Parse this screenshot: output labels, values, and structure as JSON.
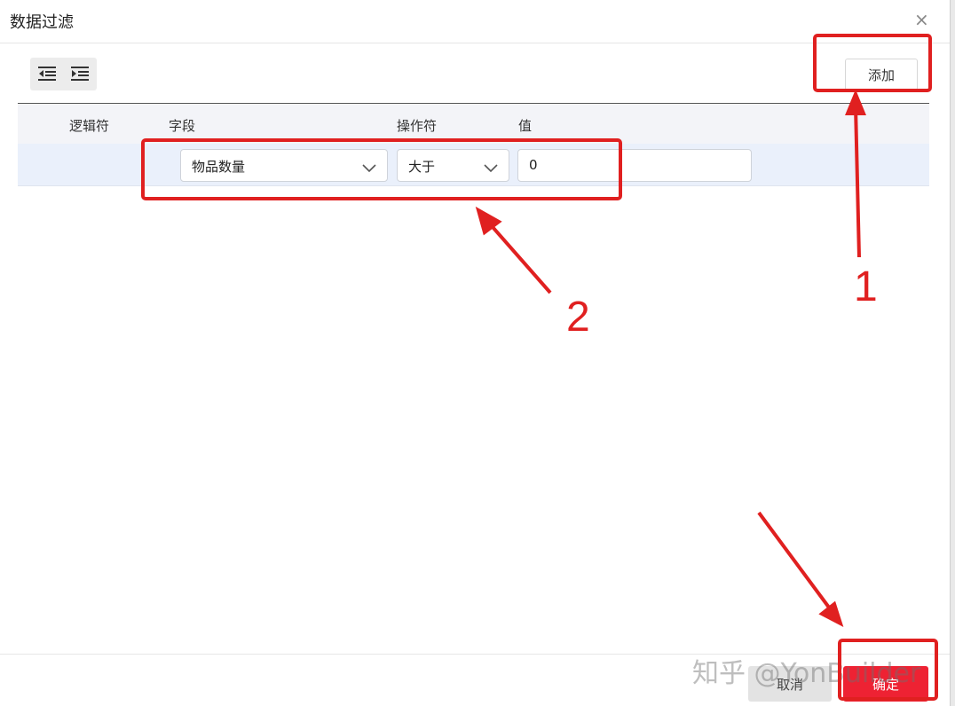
{
  "dialog": {
    "title": "数据过滤",
    "close_glyph": "×"
  },
  "toolbar": {
    "icons": [
      "outdent-icon",
      "indent-icon"
    ],
    "add_label": "添加"
  },
  "table": {
    "headers": [
      "逻辑符",
      "字段",
      "操作符",
      "值"
    ],
    "rows": [
      {
        "field": "物品数量",
        "operator": "大于",
        "value": "0"
      }
    ]
  },
  "footer": {
    "cancel_label": "取消",
    "ok_label": "确定"
  },
  "watermark": "知乎 @YonBuilder",
  "annotations": {
    "label_1": "1",
    "label_2": "2",
    "color": "#e02020"
  },
  "colors": {
    "primary": "#ee2233",
    "annotation": "#e02020"
  }
}
